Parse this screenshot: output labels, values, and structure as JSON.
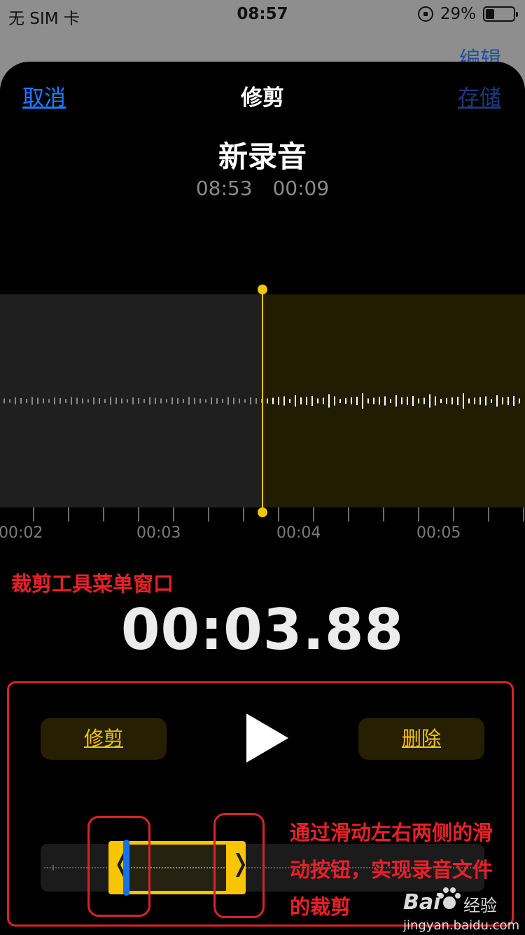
{
  "status_bar": {
    "carrier": "无 SIM 卡",
    "time": "08:57",
    "battery_percent": "29%"
  },
  "background": {
    "edit_label": "编辑"
  },
  "nav": {
    "cancel_label": "取消",
    "title": "修剪",
    "save_label": "存储"
  },
  "recording": {
    "title": "新录音",
    "created_time": "08:53",
    "duration": "00:09"
  },
  "timeline": {
    "ruler_labels": [
      "00:02",
      "00:03",
      "00:04",
      "00:05"
    ]
  },
  "current_time": "00:03.88",
  "controls": {
    "trim_label": "修剪",
    "delete_label": "删除"
  },
  "scrubber": {
    "left_handle_glyph": "❬",
    "right_handle_glyph": "❭"
  },
  "annotations": {
    "top": "裁剪工具菜单窗口",
    "bottom": "通过滑动左右两侧的滑动按钮，实现录音文件的裁剪"
  },
  "watermark": {
    "brand": "Bai",
    "sub": "经验",
    "url": "jingyan.baidu.com"
  },
  "colors": {
    "accent_yellow": "#f7c600",
    "link_blue": "#1a7bff",
    "annotation_red": "#e8202a",
    "cursor_blue": "#1672e8"
  }
}
